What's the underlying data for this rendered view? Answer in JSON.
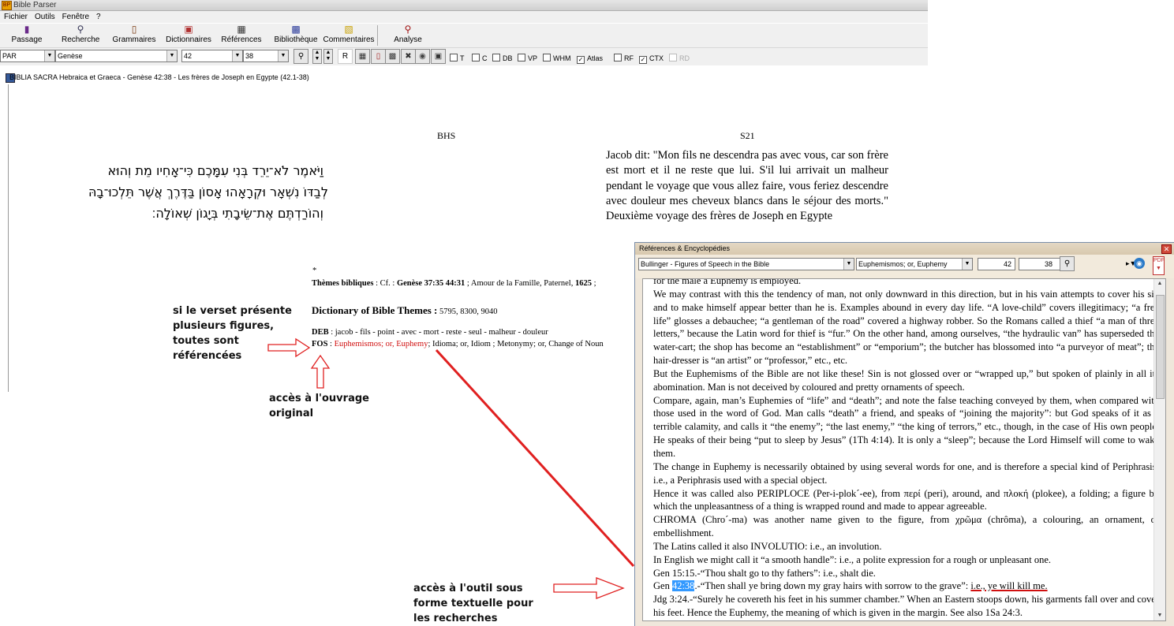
{
  "app": {
    "title": "Bible Parser",
    "logo": "BP"
  },
  "menu": [
    "Fichier",
    "Outils",
    "Fenêtre",
    "?"
  ],
  "toolbar": {
    "buttons": [
      {
        "label": "Passage",
        "icon": "book-icon"
      },
      {
        "label": "Recherche",
        "icon": "search-icon"
      },
      {
        "label": "Grammaires",
        "icon": "books-icon"
      },
      {
        "label": "Dictionnaires",
        "icon": "dictionary-icon"
      },
      {
        "label": "Références",
        "icon": "references-icon"
      },
      {
        "label": "Bibliothèque",
        "icon": "library-icon"
      },
      {
        "label": "Commentaires",
        "icon": "comments-icon"
      },
      {
        "label": "Analyse",
        "icon": "analyse-icon"
      }
    ]
  },
  "combobar": {
    "version": "PAR",
    "book": "Genèse",
    "chapter": "42",
    "verse": "38",
    "r_label": "R",
    "checks": [
      {
        "label": "T",
        "checked": false
      },
      {
        "label": "C",
        "checked": false
      },
      {
        "label": "DB",
        "checked": false
      },
      {
        "label": "VP",
        "checked": false
      },
      {
        "label": "WHM",
        "checked": false
      },
      {
        "label": "Atlas",
        "checked": true
      },
      {
        "label": "RF",
        "checked": false
      },
      {
        "label": "CTX",
        "checked": true
      },
      {
        "label": "RD",
        "checked": false
      }
    ]
  },
  "document": {
    "title": "BIBLIA SACRA Hebraica et Graeca - Genèse 42:38 - Les frères de Joseph en Egypte (42.1-38)",
    "col_left": "BHS",
    "col_right": "S21",
    "hebrew": [
      "וַיֹּאמֶר לֹא־יֵרֵד בְּנִי עִמָּכֶם כִּי־אָחִיו מֵת וְהוּא",
      "לְבַדּוֹ נִשְׁאָר וּקְרָאָהוּ אָסוֹן בַּדֶּרֶךְ אֲשֶׁר תֵּלְכוּ־בָהּ",
      "וְהוֹרַדְתֶּם אֶת־שֵׂיבָתִי בְּיָגוֹן שְׁאוֹלָה׃"
    ],
    "french": "Jacob dit: \"Mon fils ne descendra pas avec vous, car son frère est mort et il ne reste que lui. S'il lui arrivait un malheur pendant le voyage que vous allez faire, vous feriez descendre avec douleur mes cheveux blancs dans le séjour des morts.\" Deuxième voyage des frères de Joseph en Egypte",
    "star": "*",
    "themes": {
      "label": "Thèmes bibliques",
      "cf": ": Cf. :",
      "ref1": "Genèse 37:35 44:31",
      "text": "; Amour de la Famille, Paternel,",
      "num": "1625",
      "tail": ";"
    },
    "dbt": {
      "label": "Dictionary of Bible Themes :",
      "values": "5795, 8300, 9040"
    },
    "deb": {
      "label": "DEB",
      "text": ": jacob - fils - point - avec - mort - reste - seul - malheur - douleur"
    },
    "fos": {
      "label": "FOS",
      "colon": ":",
      "link": "Euphemismos; or, Euphemy",
      "text": "; Idioma; or, Idiom ; Metonymy; or, Change of Noun"
    }
  },
  "annotations": {
    "a1": [
      "si le verset présente",
      "plusieurs figures,",
      "toutes sont",
      "référencées"
    ],
    "a2": [
      "accès à l'ouvrage",
      "original"
    ],
    "a3": [
      "accès à l'outil sous",
      "forme textuelle pour",
      "les recherches"
    ]
  },
  "refwin": {
    "title": "Références & Encyclopédies",
    "work": "Bullinger - Figures of Speech in the Bible",
    "entry": "Euphemismos; or, Euphemy",
    "chapter": "42",
    "verse": "38",
    "paragraphs": [
      "for the male a Euphemy is employed.",
      "We may contrast with this the tendency of man, not only downward in this direction, but in his vain attempts to cover his sin and to make himself appear better than he is. Examples abound in every day life. “A love-child” covers illegitimacy; “a free life” glosses a debauchee; “a gentleman of the road” covered a highway robber. So the Romans called a thief “a man of three letters,” because the Latin word for thief is “fur.” On the other hand, among ourselves, “the hydraulic van” has superseded the water-cart; the shop has become an “establishment” or “emporium”; the butcher has blossomed into “a purveyor of meat”; the hair-dresser is “an artist” or “professor,” etc., etc.",
      "But the Euphemisms of the Bible are not like these! Sin is not glossed over or “wrapped up,” but spoken of plainly in all its abomination. Man is not deceived by coloured and pretty ornaments of speech.",
      "Compare, again, man’s Euphemies of “life” and “death”; and note the false teaching conveyed by them, when compared with those used in the word of God. Man calls “death” a friend, and speaks of “joining the majority”: but God speaks of it as a terrible calamity, and calls it “the enemy”; “the last enemy,” “the king of terrors,” etc., though, in the case of His own people, He speaks of their being “put to sleep by Jesus” (1Th 4:14). It is only a “sleep”; because the Lord Himself will come to wake them.",
      "The change in Euphemy is necessarily obtained by using several words for one, and is therefore a special kind of Periphrasis: i.e., a Periphrasis used with a special object.",
      "Hence it was called also PERIPLOCE (Per-i-plok´-ee), from περί (peri), around, and πλοκή (plokee), a folding; a figure by which the unpleasantness of a thing is wrapped round and made to appear agreeable.",
      "CHROMA (Chro´-ma) was another name given to the figure, from χρῶμα (chrôma), a colouring, an ornament, or embellishment.",
      "The Latins called it also INVOLUTIO: i.e., an involution.",
      "In English we might call it “a smooth handle”: i.e., a polite expression for a rough or unpleasant one.",
      "Gen 15:15.-“Thou shalt go to thy fathers”: i.e., shalt die."
    ],
    "gen42": {
      "pre": "Gen ",
      "ref": "42:38",
      "mid": ".-“Then shall ye bring down my gray hairs with sorrow to the grave”: ",
      "ul": "i.e., ye will kill me."
    },
    "last": "Jdg 3:24.-“Surely he covereth his feet in his summer chamber.” When an Eastern stoops down, his garments fall over and cover his feet. Hence the Euphemy, the meaning of which is given in the margin. See also 1Sa 24:3."
  },
  "colors": {
    "arrow": "#e02020",
    "highlight": "#3399ff",
    "link": "#d01010"
  }
}
